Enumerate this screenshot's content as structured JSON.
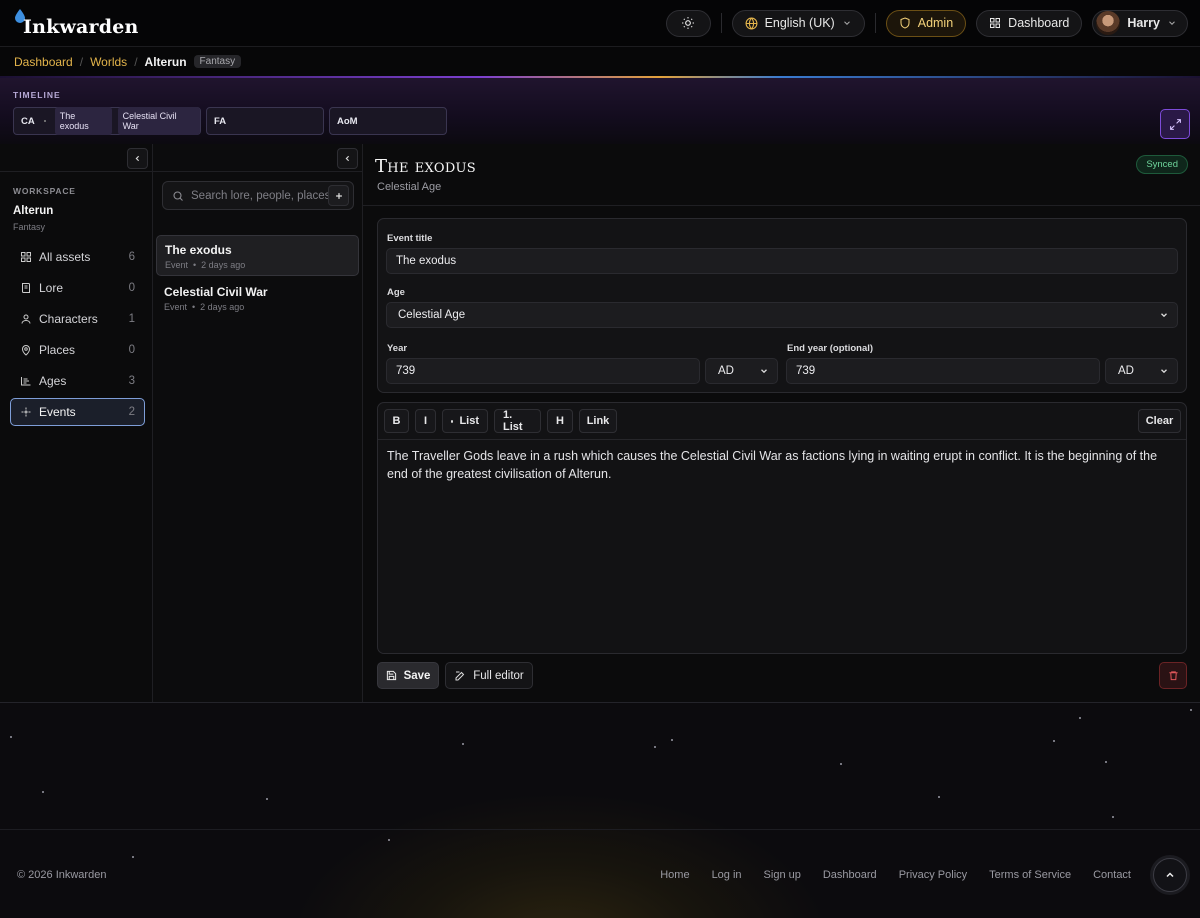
{
  "app": {
    "name": "Inkwarden",
    "theme_icon": "sun-icon",
    "language": "English (UK)",
    "admin_label": "Admin",
    "dashboard_label": "Dashboard",
    "user_name": "Harry"
  },
  "breadcrumb": {
    "items": [
      "Dashboard",
      "Worlds"
    ],
    "current": "Alterun",
    "genre_tag": "Fantasy"
  },
  "timeline": {
    "label": "TIMELINE",
    "ages": [
      {
        "abbr": "CA",
        "events": [
          "The exodus",
          "Celestial Civil War"
        ]
      },
      {
        "abbr": "FA",
        "events": []
      },
      {
        "abbr": "AoM",
        "events": []
      }
    ]
  },
  "sidebar": {
    "section_label": "WORKSPACE",
    "workspace_name": "Alterun",
    "workspace_genre": "Fantasy",
    "items": [
      {
        "label": "All assets",
        "count": "6",
        "icon": "grid-icon"
      },
      {
        "label": "Lore",
        "count": "0",
        "icon": "book-icon"
      },
      {
        "label": "Characters",
        "count": "1",
        "icon": "person-icon"
      },
      {
        "label": "Places",
        "count": "0",
        "icon": "map-pin-icon"
      },
      {
        "label": "Ages",
        "count": "3",
        "icon": "timeline-icon"
      },
      {
        "label": "Events",
        "count": "2",
        "icon": "sparkle-icon"
      }
    ]
  },
  "list": {
    "search_placeholder": "Search lore, people, places.",
    "items": [
      {
        "title": "The exodus",
        "type": "Event",
        "time": "2 days ago"
      },
      {
        "title": "Celestial Civil War",
        "type": "Event",
        "time": "2 days ago"
      }
    ]
  },
  "event": {
    "heading": "The exodus",
    "age": "Celestial Age",
    "status": "Synced",
    "form": {
      "title_label": "Event title",
      "title_value": "The exodus",
      "age_label": "Age",
      "age_value": "Celestial Age",
      "year_label": "Year",
      "year_value": "739",
      "year_era": "AD",
      "end_year_label": "End year (optional)",
      "end_year_value": "739",
      "end_year_era": "AD"
    },
    "toolbar": {
      "bold": "B",
      "italic": "I",
      "bullet_list": "List",
      "numbered_list": "1. List",
      "heading": "H",
      "link": "Link",
      "clear": "Clear"
    },
    "body": "The Traveller Gods leave in a rush which causes the Celestial Civil War as factions lying in waiting erupt in conflict. It is the beginning of the end of the greatest civilisation of Alterun.",
    "save_label": "Save",
    "full_editor_label": "Full editor"
  },
  "footer": {
    "copyright": "© 2026 Inkwarden",
    "links": [
      "Home",
      "Log in",
      "Sign up",
      "Dashboard",
      "Privacy Policy",
      "Terms of Service",
      "Contact"
    ]
  },
  "colors": {
    "accent_gold": "#e3b44b",
    "accent_purple": "#7d4bd8",
    "synced_green": "#6fd59c",
    "danger_red": "#d0474b"
  }
}
